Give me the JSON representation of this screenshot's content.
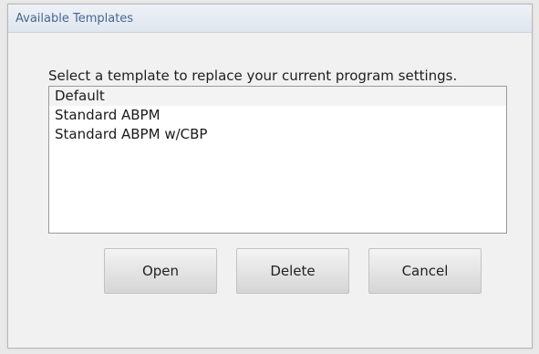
{
  "window": {
    "title": "Available Templates"
  },
  "dialog": {
    "prompt": "Select a template to replace your current program settings.",
    "templates": [
      {
        "label": "Default",
        "selected": true
      },
      {
        "label": "Standard ABPM",
        "selected": false
      },
      {
        "label": "Standard ABPM w/CBP",
        "selected": false
      }
    ]
  },
  "buttons": {
    "open_label": "Open",
    "delete_label": "Delete",
    "cancel_label": "Cancel"
  },
  "colors": {
    "title_text": "#4a6690",
    "selection_bg": "#f3f3f3"
  }
}
